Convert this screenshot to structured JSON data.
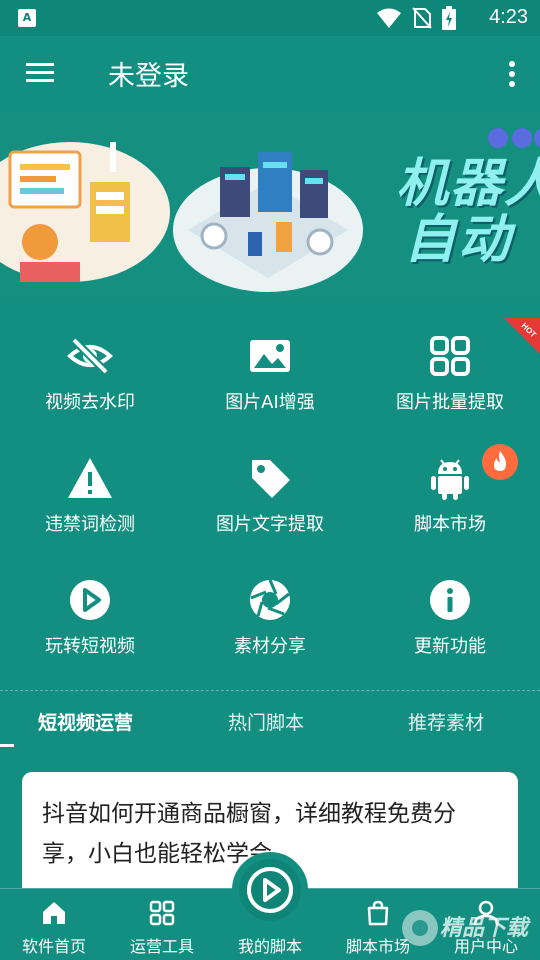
{
  "status_bar": {
    "time": "4:23",
    "app_badge": "A"
  },
  "app_bar": {
    "title": "未登录"
  },
  "banner": {
    "text_line1": "机器人",
    "text_line2": "自动"
  },
  "features": [
    {
      "label": "视频去水印",
      "icon": "eye-off-icon"
    },
    {
      "label": "图片AI增强",
      "icon": "image-icon"
    },
    {
      "label": "图片批量提取",
      "icon": "grid-icon",
      "badge": "HOT"
    },
    {
      "label": "违禁词检测",
      "icon": "warning-icon"
    },
    {
      "label": "图片文字提取",
      "icon": "tag-icon"
    },
    {
      "label": "脚本市场",
      "icon": "android-icon",
      "badge": "fire"
    },
    {
      "label": "玩转短视频",
      "icon": "play-circle-icon"
    },
    {
      "label": "素材分享",
      "icon": "aperture-icon"
    },
    {
      "label": "更新功能",
      "icon": "info-icon"
    }
  ],
  "tabs": [
    {
      "label": "短视频运营",
      "active": true
    },
    {
      "label": "热门脚本",
      "active": false
    },
    {
      "label": "推荐素材",
      "active": false
    }
  ],
  "article": {
    "title": "抖音如何开通商品橱窗，详细教程免费分享，小白也能轻松学会"
  },
  "bottom_nav": [
    {
      "label": "软件首页",
      "icon": "home-icon"
    },
    {
      "label": "运营工具",
      "icon": "grid-icon"
    },
    {
      "label": "我的脚本",
      "icon": "play-circle-icon"
    },
    {
      "label": "脚本市场",
      "icon": "shopping-bag-icon"
    },
    {
      "label": "用户中心",
      "icon": "user-icon"
    }
  ],
  "watermark": {
    "text": "精品下载"
  },
  "colors": {
    "primary": "#128f80",
    "card": "#ffffff",
    "fire": "#ff6b3d",
    "hot": "#e53935"
  }
}
